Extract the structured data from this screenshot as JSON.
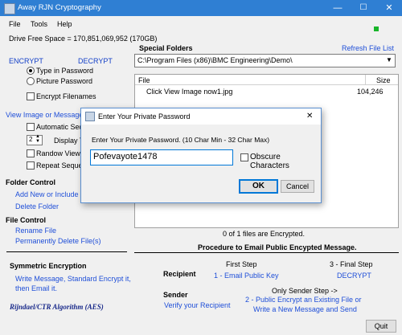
{
  "window": {
    "title": "Away RJN  Cryptography",
    "minimize": "—",
    "maximize": "☐",
    "close": "✕"
  },
  "menu": {
    "items": [
      "File",
      "Tools",
      "Help"
    ]
  },
  "drive": {
    "free_space": "Drive Free Space = 170,851,069,952    (170GB)"
  },
  "left": {
    "encrypt": "ENCRYPT",
    "decrypt": "DECRYPT",
    "type_in_password": "Type in Password",
    "picture_password": "Picture Password",
    "encrypt_filenames": "Encrypt Filenames",
    "view_image_header": "View Image or Message F",
    "automatic_seq": "Automatic Sequ",
    "display_count": "2",
    "display_time": "Display Ti",
    "random_view": "Randow View",
    "repeat_seq": "Repeat Sequenc",
    "folder_control": "Folder Control",
    "add_new": "Add New or Include an",
    "delete_folder": "Delete Folder",
    "file_control": "File Control",
    "rename_file": "Rename File",
    "perm_delete": "Permanently Delete File(s)",
    "sym_title": "Symmetric Encryption",
    "sym_link1": "Write Message, Standard Encrypt it,",
    "sym_link2": "then Email it.",
    "algorithm": "Rijndael/CTR Algorithm (AES)"
  },
  "special": {
    "title": "Special Folders",
    "refresh": "Refresh File List",
    "path": "C:\\Program Files (x86)\\BMC Engineering\\Demo\\",
    "col_file": "File",
    "col_size": "Size",
    "rows": [
      {
        "file": "Click View Image now1.jpg",
        "size": "104,246"
      }
    ],
    "status": "0 of 1 files are Encrypted."
  },
  "email": {
    "title": "Procedure to Email Public Encypted Message.",
    "first_step": "First Step",
    "final_step": "3 - Final Step",
    "recipient": "Recipient",
    "email_public_key": "1 - Email Public Key",
    "decrypt": "DECRYPT",
    "only_sender": "Only Sender Step ->",
    "sender": "Sender",
    "verify_recipient": "Verify your Recipient",
    "step2_line1": "2 - Public Encrypt an Existing File or",
    "step2_line2": "Write a New Message and Send",
    "quit": "Quit"
  },
  "dialog": {
    "title": "Enter Your Private Password",
    "prompt": "Enter Your Private Password. (10 Char Min - 32 Char Max)",
    "password": "Pofevayote1478",
    "obscure": "Obscure Characters",
    "ok": "OK",
    "cancel": "Cancel",
    "close": "✕"
  },
  "colors": {
    "titlebar": "#2f7fd3",
    "link": "#1f4fd8",
    "status_green": "#18b52a"
  }
}
